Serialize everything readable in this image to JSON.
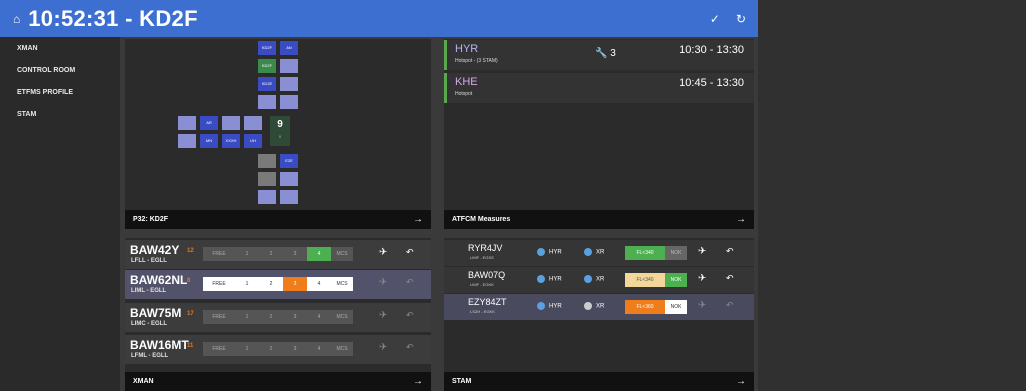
{
  "header": {
    "title": "10:52:31 - KD2F",
    "home_icon": "⌂",
    "check_icon": "✓",
    "refresh_icon": "↻"
  },
  "sidebar": {
    "items": [
      {
        "label": "XMAN"
      },
      {
        "label": "CONTROL ROOM"
      },
      {
        "label": "ETFMS PROFILE"
      },
      {
        "label": "STAM"
      }
    ]
  },
  "map_panel": {
    "footer": "P32: KD2F",
    "arrow": "→",
    "labels": {
      "c1": "KD2F",
      "c2": "AN",
      "c3": "KD2F",
      "c4": "KD2E",
      "c5": "AR",
      "c6": "MN",
      "c7": "XXXH",
      "c8": "UH",
      "c9": "E2E"
    },
    "center_big": "9",
    "center_small": "0"
  },
  "measures_panel": {
    "footer": "ATFCM Measures",
    "arrow": "→",
    "items": [
      {
        "name": "HYR",
        "sub": "Hotspot - (3 STAM)",
        "tool": "🔧 3",
        "time": "10:30 - 13:30"
      },
      {
        "name": "KHE",
        "sub": "Hotspot",
        "tool": "",
        "time": "10:45 - 13:30"
      }
    ]
  },
  "xman_panel": {
    "footer": "XMAN",
    "arrow": "→",
    "options": [
      "FREE",
      "1",
      "2",
      "3",
      "4",
      "MCS"
    ],
    "plane": "✈",
    "undo": "↶",
    "rows": [
      {
        "call": "BAW42Y",
        "route": "LFLL - EGLL",
        "delay": "12"
      },
      {
        "call": "BAW62NL",
        "route": "LIML - EGLL",
        "delay": "8"
      },
      {
        "call": "BAW75M",
        "route": "LIMC - EGLL",
        "delay": "17"
      },
      {
        "call": "BAW16MT",
        "route": "LFML - EGLL",
        "delay": "11"
      }
    ]
  },
  "stam_panel": {
    "footer": "STAM",
    "arrow": "→",
    "plane": "✈",
    "undo": "↶",
    "rows": [
      {
        "call": "RYR4JV",
        "route": "LIMF - EGSS",
        "ms": "HYR",
        "xr": "XR",
        "fl": "FL<340",
        "nok": "NOK"
      },
      {
        "call": "BAW07Q",
        "route": "LIMF - EGKK",
        "ms": "HYR",
        "xr": "XR",
        "fl": "FL<340",
        "nok": "NOK"
      },
      {
        "call": "EZY84ZT",
        "route": "LSZH - EGKK",
        "ms": "HYR",
        "xr": "XR",
        "fl": "FL<360",
        "nok": "NOK"
      }
    ]
  }
}
